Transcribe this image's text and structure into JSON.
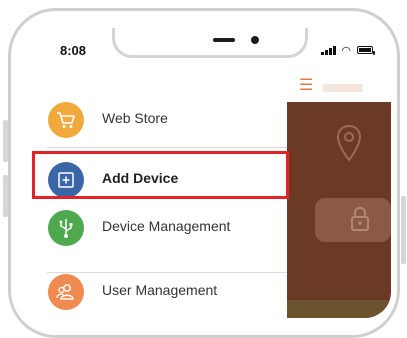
{
  "status_bar": {
    "time": "8:08"
  },
  "app": {
    "menu_icon": "hamburger-menu-icon",
    "accent_color": "#e0784a",
    "background_color": "#6a3a25"
  },
  "drawer": {
    "items": [
      {
        "label": "Web Store",
        "icon": "shopping-cart-icon",
        "color": "#f0a93c"
      },
      {
        "label": "Add Device",
        "icon": "add-square-icon",
        "color": "#3a66a8",
        "highlighted": true
      },
      {
        "label": "Device Management",
        "icon": "usb-icon",
        "color": "#4ea84e"
      },
      {
        "label": "User Management",
        "icon": "users-icon",
        "color": "#ef8a50"
      }
    ],
    "highlight_color": "#e2232a"
  }
}
